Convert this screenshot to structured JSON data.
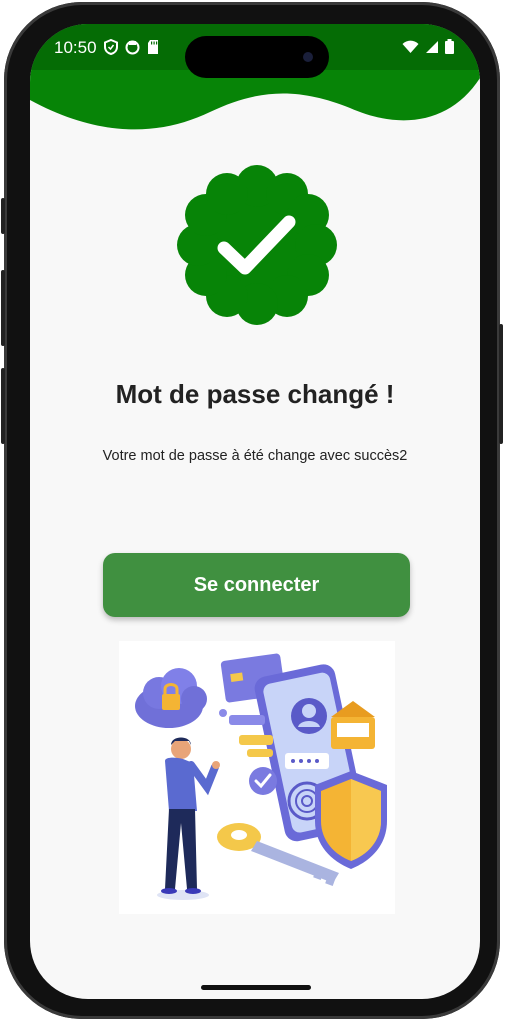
{
  "status_bar": {
    "time": "10:50",
    "left_icons": [
      "shield-icon",
      "circle-status-icon",
      "sd-card-icon"
    ],
    "right_icons": [
      "wifi-icon",
      "signal-icon",
      "battery-icon"
    ]
  },
  "colors": {
    "brand_green": "#078407",
    "button_green": "#409040",
    "background": "#f8f8f8"
  },
  "success": {
    "icon": "verified-check-badge-icon",
    "title": "Mot de passe changé !",
    "message": "Votre mot de passe à été change avec succès2"
  },
  "actions": {
    "connect_label": "Se connecter"
  },
  "illustration": {
    "icon": "security-illustration"
  }
}
